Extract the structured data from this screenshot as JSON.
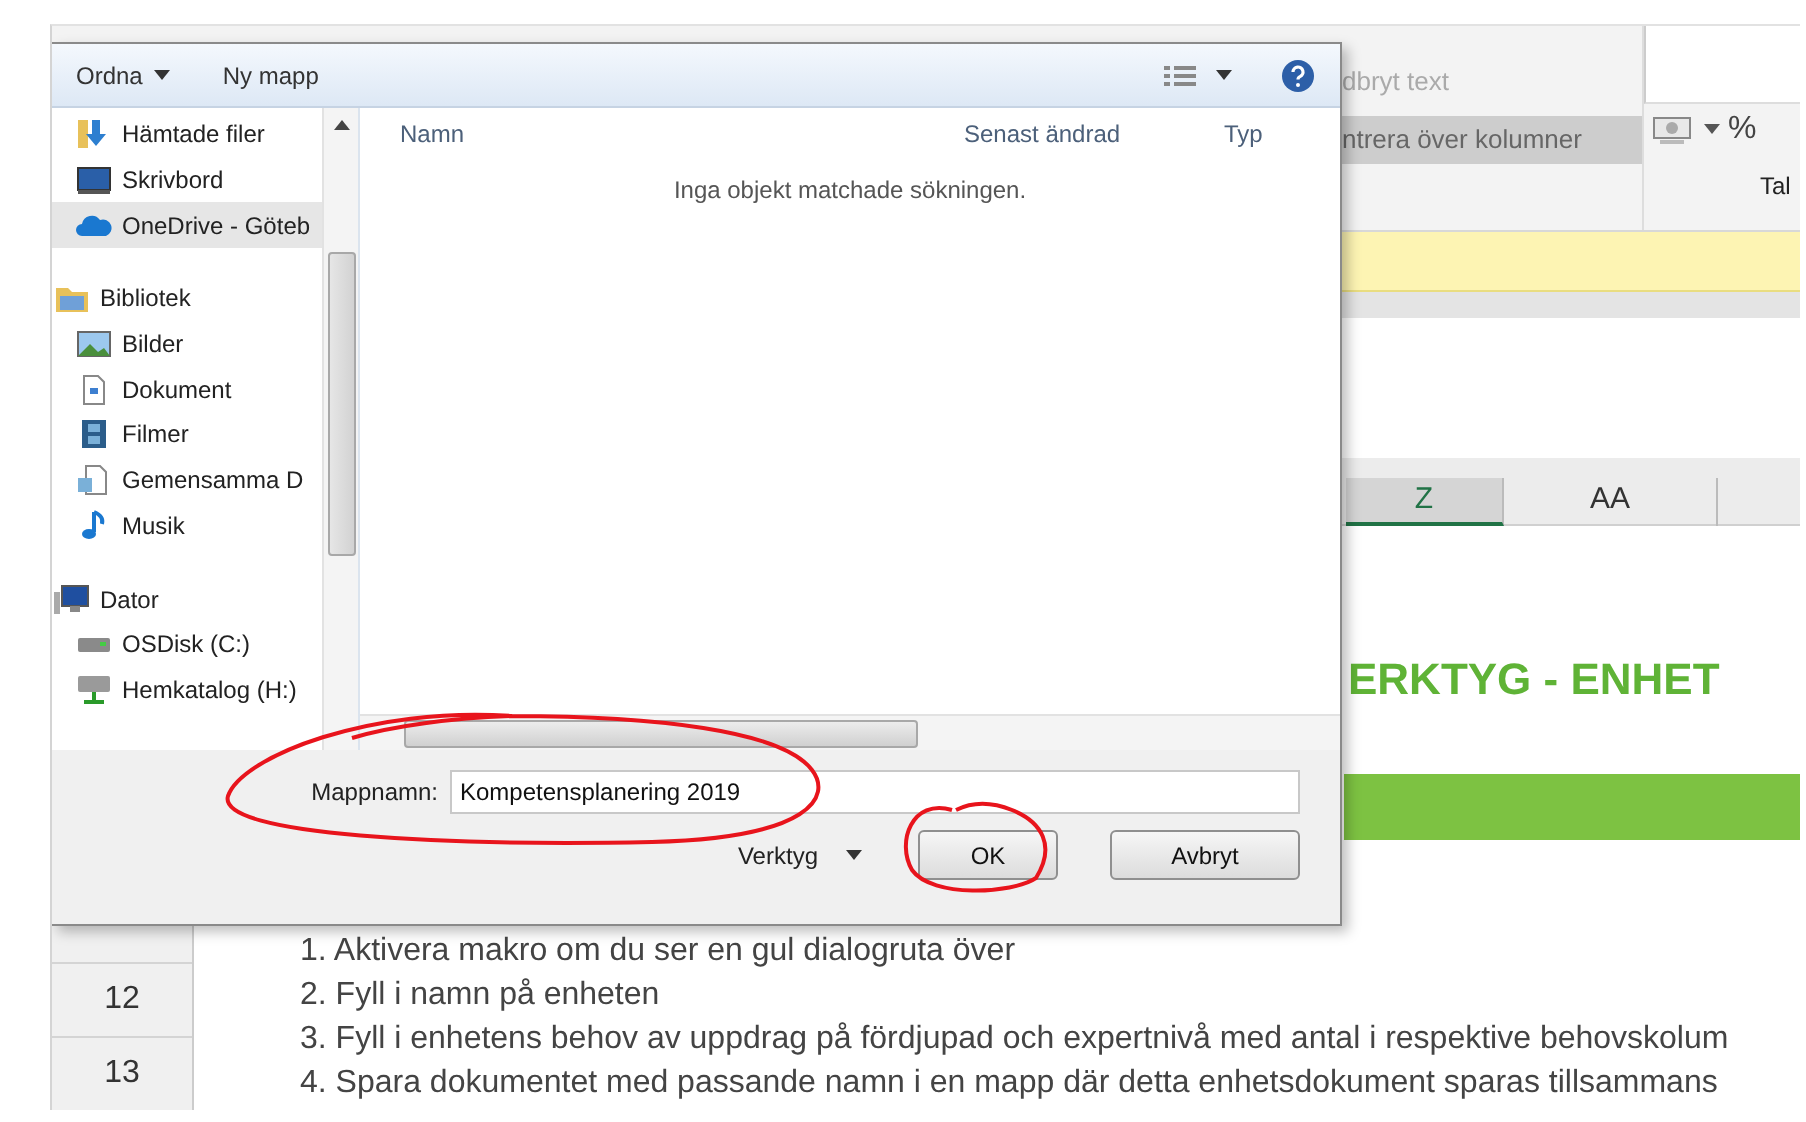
{
  "spreadsheet": {
    "ribbon": {
      "wrap_text": "dbryt text",
      "merge_button": "ntrera över kolumner",
      "percent": "%",
      "group_label": "Tal"
    },
    "columns": [
      {
        "label": "Z",
        "selected": true
      },
      {
        "label": "AA",
        "selected": false
      }
    ],
    "title": "ERKTYG - ENHET",
    "rows": [
      {
        "number": "12"
      },
      {
        "number": "13"
      }
    ],
    "instructions": [
      "1. Aktivera makro om du ser en gul dialogruta över",
      "2. Fyll i namn på enheten",
      "3. Fyll i enhetens behov av uppdrag på fördjupad och expertnivå med antal i respektive behovskolum",
      "4. Spara dokumentet med passande namn i en mapp där detta enhetsdokument sparas tillsammans"
    ]
  },
  "dialog": {
    "toolbar": [
      {
        "label": "Ordna",
        "dropdown": true
      },
      {
        "label": "Ny mapp",
        "dropdown": false
      }
    ],
    "nav": [
      {
        "children": [
          {
            "label": "Hämtade filer",
            "kind": "downloads",
            "selected": false
          },
          {
            "label": "Skrivbord",
            "kind": "desktop",
            "selected": false
          },
          {
            "label": "OneDrive - Göteb",
            "kind": "cloud",
            "selected": true
          }
        ]
      },
      {
        "label": "Bibliotek",
        "kind": "library",
        "selected": false,
        "children": [
          {
            "label": "Bilder",
            "kind": "pictures",
            "selected": false
          },
          {
            "label": "Dokument",
            "kind": "documents",
            "selected": false
          },
          {
            "label": "Filmer",
            "kind": "videos",
            "selected": false
          },
          {
            "label": "Gemensamma D",
            "kind": "shared",
            "selected": false
          },
          {
            "label": "Musik",
            "kind": "music",
            "selected": false
          }
        ]
      },
      {
        "label": "Dator",
        "kind": "computer",
        "selected": false,
        "children": [
          {
            "label": "OSDisk (C:)",
            "kind": "disk",
            "selected": false
          },
          {
            "label": "Hemkatalog (H:)",
            "kind": "network",
            "selected": false
          }
        ]
      }
    ],
    "columns": [
      "Namn",
      "Senast ändrad",
      "Typ"
    ],
    "empty_message": "Inga objekt matchade sökningen.",
    "folder_name": {
      "label": "Mappnamn:",
      "value": "Kompetensplanering 2019"
    },
    "buttons": [
      {
        "label": "Verktyg",
        "kind": "menu"
      },
      {
        "label": "OK",
        "kind": "push"
      },
      {
        "label": "Avbryt",
        "kind": "push"
      }
    ]
  }
}
